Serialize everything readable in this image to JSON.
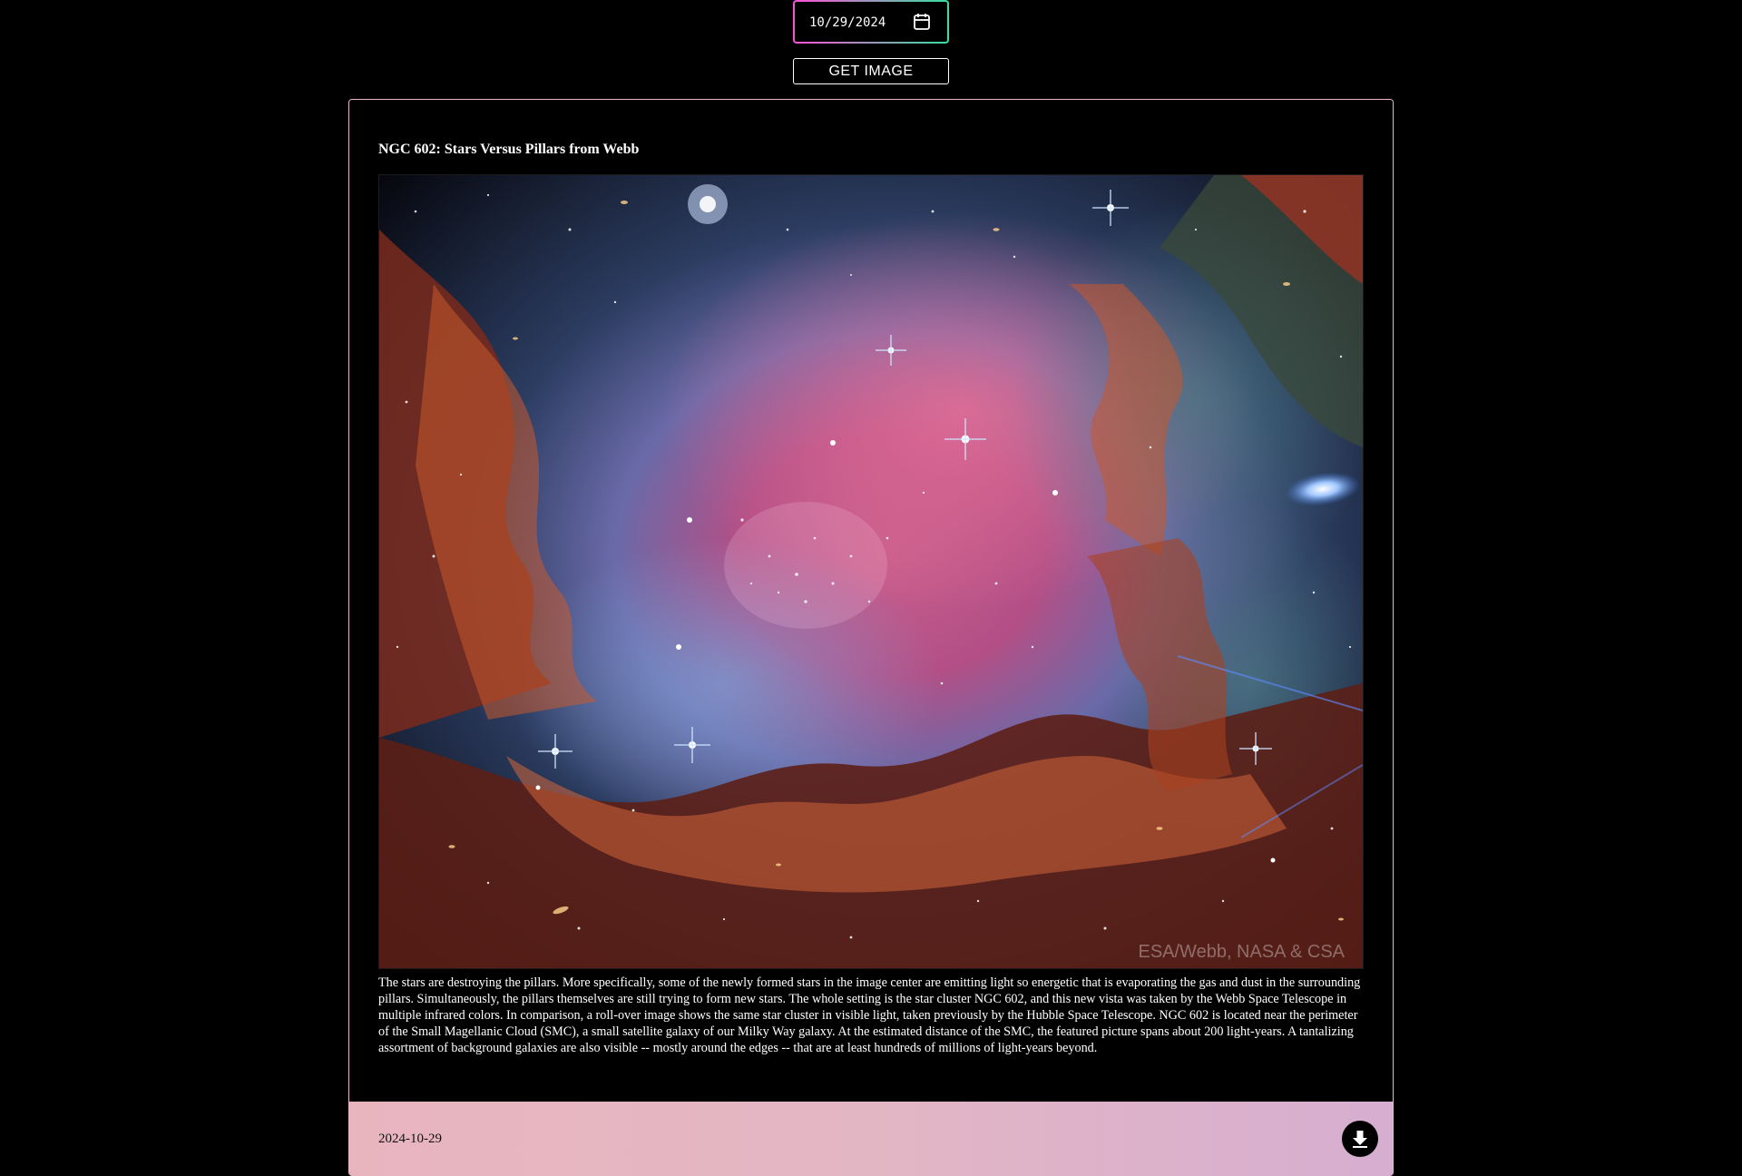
{
  "controls": {
    "date_value": "10/29/2024",
    "get_button_label": "GET IMAGE"
  },
  "apod": {
    "title": "NGC 602: Stars Versus Pillars from Webb",
    "credit_watermark": "ESA/Webb, NASA & CSA",
    "description": "The stars are destroying the pillars. More specifically, some of the newly formed stars in the image center are emitting light so energetic that is evaporating the gas and dust in the surrounding pillars. Simultaneously, the pillars themselves are still trying to form new stars. The whole setting is the star cluster NGC 602, and this new vista was taken by the Webb Space Telescope in multiple infrared colors. In comparison, a roll-over image shows the same star cluster in visible light, taken previously by the Hubble Space Telescope. NGC 602 is located near the perimeter of the Small Magellanic Cloud (SMC), a small satellite galaxy of our Milky Way galaxy. At the estimated distance of the SMC, the featured picture spans about 200 light-years. A tantalizing assortment of background galaxies are also visible -- mostly around the edges -- that are at least hundreds of millions of light-years beyond.",
    "date": "2024-10-29"
  },
  "icons": {
    "calendar": "calendar-icon",
    "download": "download-arrow-icon"
  },
  "colors": {
    "background": "#000000",
    "input_border_start": "#ff4fd8",
    "input_border_end": "#35e0a0",
    "footer_gradient_start": "#e8b5bf",
    "footer_gradient_end": "#d6aed0"
  }
}
